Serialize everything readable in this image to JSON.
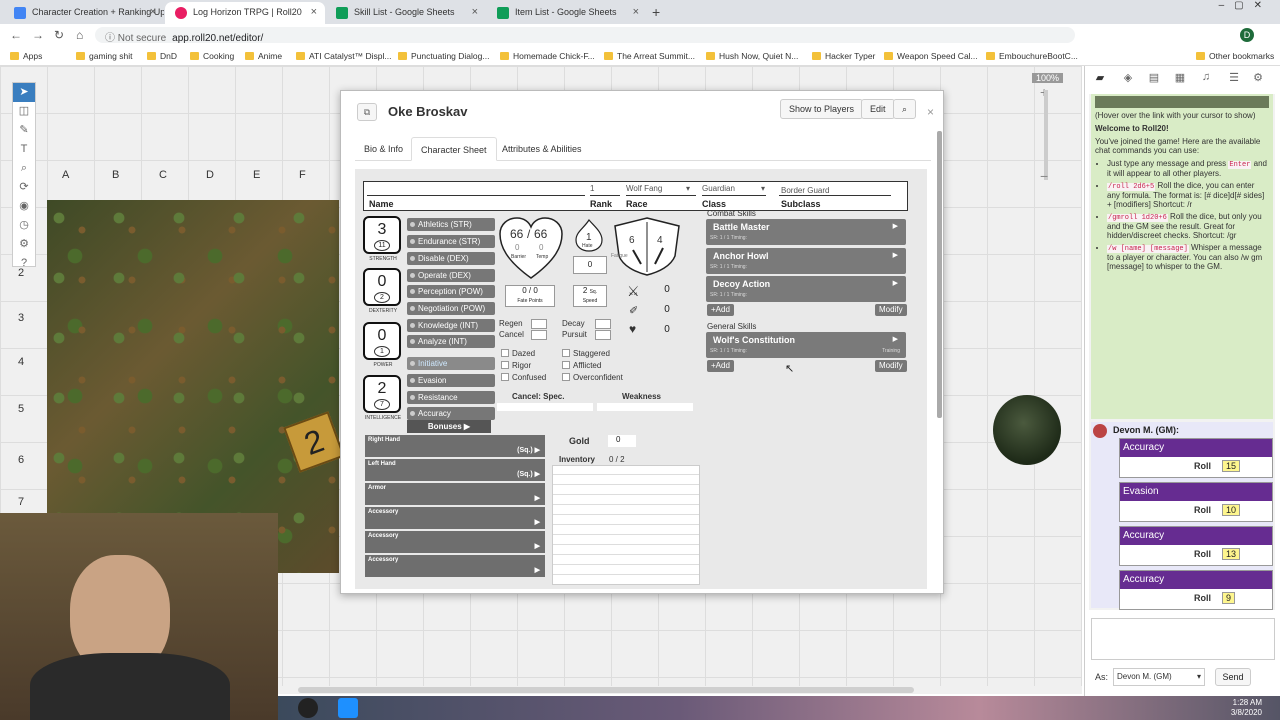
{
  "browser": {
    "tabs": [
      {
        "title": "Character Creation + Ranking Up",
        "color": "#4285f4"
      },
      {
        "title": "Log Horizon TRPG | Roll20",
        "color": "#e91e63"
      },
      {
        "title": "Skill List - Google Sheets",
        "color": "#0f9d58"
      },
      {
        "title": "Item List - Google Sheets",
        "color": "#0f9d58"
      }
    ],
    "tab_close": "×",
    "new_tab": "+",
    "security": "Not secure",
    "url": "app.roll20.net/editor/",
    "profile_initial": "D",
    "bookmarks": [
      "Apps",
      "gaming shit",
      "DnD",
      "Cooking",
      "Anime",
      "ATI Catalyst™ Displ...",
      "Punctuating Dialog...",
      "Homemade Chick-F...",
      "The Arreat Summit...",
      "Hush Now, Quiet N...",
      "Hacker Typer",
      "Weapon Speed Cal...",
      "EmbouchureBootC...",
      "Other bookmarks"
    ]
  },
  "vtt": {
    "columns": [
      "A",
      "B",
      "C",
      "D",
      "E",
      "F"
    ],
    "rows": [
      "2",
      "3",
      "4",
      "5",
      "6",
      "7"
    ],
    "zoom": "100%",
    "token_label": "2"
  },
  "dialog": {
    "title": "Oke Broskav",
    "show_players": "Show to Players",
    "edit": "Edit",
    "close": "×",
    "tabs": [
      "Bio & Info",
      "Character Sheet",
      "Attributes & Abilities"
    ],
    "header": {
      "rank_value": "1",
      "race_value": "Wolf Fang",
      "class_value": "Guardian",
      "subclass_value": "Border Guard",
      "labels": {
        "name": "Name",
        "rank": "Rank",
        "race": "Race",
        "class": "Class",
        "subclass": "Subclass"
      }
    },
    "stats": [
      {
        "value": "3",
        "sub": "11",
        "label": "STRENGTH"
      },
      {
        "value": "0",
        "sub": "2",
        "label": "DEXTERITY"
      },
      {
        "value": "0",
        "sub": "1",
        "label": "POWER"
      },
      {
        "value": "2",
        "sub": "7",
        "label": "INTELLIGENCE"
      }
    ],
    "skills": [
      "Athletics (STR)",
      "Endurance (STR)",
      "Disable (DEX)",
      "Operate (DEX)",
      "Perception (POW)",
      "Negotiation (POW)",
      "Knowledge (INT)",
      "Analyze (INT)"
    ],
    "combat_stats": [
      "Initiative",
      "Evasion",
      "Resistance",
      "Accuracy"
    ],
    "bonuses": "Bonuses",
    "hp": {
      "current": "66",
      "max": "66",
      "barrier": "0",
      "temp": "0",
      "barrier_lbl": "Barrier",
      "temp_lbl": "Temp"
    },
    "hate": {
      "value": "1",
      "label": "Hate"
    },
    "fatigue": "0",
    "fate": {
      "current": "0",
      "max": "0",
      "label": "Fate Points"
    },
    "speed": {
      "value": "2",
      "unit": "Sq.",
      "label": "Speed"
    },
    "shield": {
      "left": "6",
      "right": "4",
      "fatigue_lbl": "Fatigue"
    },
    "weapon_vals": [
      "0",
      "0",
      "0"
    ],
    "regen": "Regen",
    "cancel": "Cancel",
    "decay": "Decay",
    "pursuit": "Pursuit",
    "conditions_left": [
      "Dazed",
      "Rigor",
      "Confused"
    ],
    "conditions_right": [
      "Staggered",
      "Afflicted",
      "Overconfident"
    ],
    "cancel_spec": "Cancel: Spec.",
    "weakness": "Weakness",
    "combat_skills_title": "Combat Skills",
    "combat_skills": [
      {
        "name": "Battle Master",
        "timing": "SR: 1 / 1 Timing:",
        "tag": ""
      },
      {
        "name": "Anchor Howl",
        "timing": "SR: 1 / 1 Timing:",
        "tag": ""
      },
      {
        "name": "Decoy Action",
        "timing": "SR: 1 / 1 Timing:",
        "tag": ""
      }
    ],
    "general_skills_title": "General Skills",
    "general_skills": [
      {
        "name": "Wolf's Constitution",
        "timing": "SR: 1 / 1 Timing:",
        "tag": "Training"
      }
    ],
    "add": "+Add",
    "modify": "Modify",
    "equipment": [
      {
        "slot": "Right Hand",
        "tag": "(Sq.)"
      },
      {
        "slot": "Left Hand",
        "tag": "(Sq.)"
      },
      {
        "slot": "Armor",
        "tag": ""
      },
      {
        "slot": "Accessory",
        "tag": ""
      },
      {
        "slot": "Accessory",
        "tag": ""
      },
      {
        "slot": "Accessory",
        "tag": ""
      }
    ],
    "gold_label": "Gold",
    "gold": "0",
    "inventory_label": "Inventory",
    "inventory_used": "0",
    "inventory_max": "2"
  },
  "chat": {
    "hover_note": "(Hover over the link with your cursor to show)",
    "welcome": "Welcome to Roll20!",
    "intro": "You've joined the game! Here are the available chat commands you can use:",
    "commands": [
      {
        "pre": "Just type any message and press ",
        "code": "Enter",
        "post": " and it will appear to all other players."
      },
      {
        "pre": "",
        "code": "/roll 2d6+5",
        "post": " Roll the dice, you can enter any formula. The format is: [# dice]d[# sides] + [modifiers] Shortcut: /r"
      },
      {
        "pre": "",
        "code": "/gmroll 1d20+6",
        "post": " Roll the dice, but only you and the GM see the result. Great for hidden/discreet checks. Shortcut: /gr"
      },
      {
        "pre": "",
        "code": "/w [name] [message]",
        "post": " Whisper a message to a player or character. You can also /w gm [message] to whisper to the GM."
      }
    ],
    "sender": "Devon M. (GM):",
    "rolls": [
      {
        "title": "Accuracy",
        "label": "Roll",
        "value": "15"
      },
      {
        "title": "Evasion",
        "label": "Roll",
        "value": "10"
      },
      {
        "title": "Accuracy",
        "label": "Roll",
        "value": "13"
      },
      {
        "title": "Accuracy",
        "label": "Roll",
        "value": "9"
      }
    ],
    "as_label": "As:",
    "as_value": "Devon M. (GM)",
    "send": "Send"
  },
  "taskbar": {
    "time": "1:28 AM",
    "date": "3/8/2020"
  }
}
